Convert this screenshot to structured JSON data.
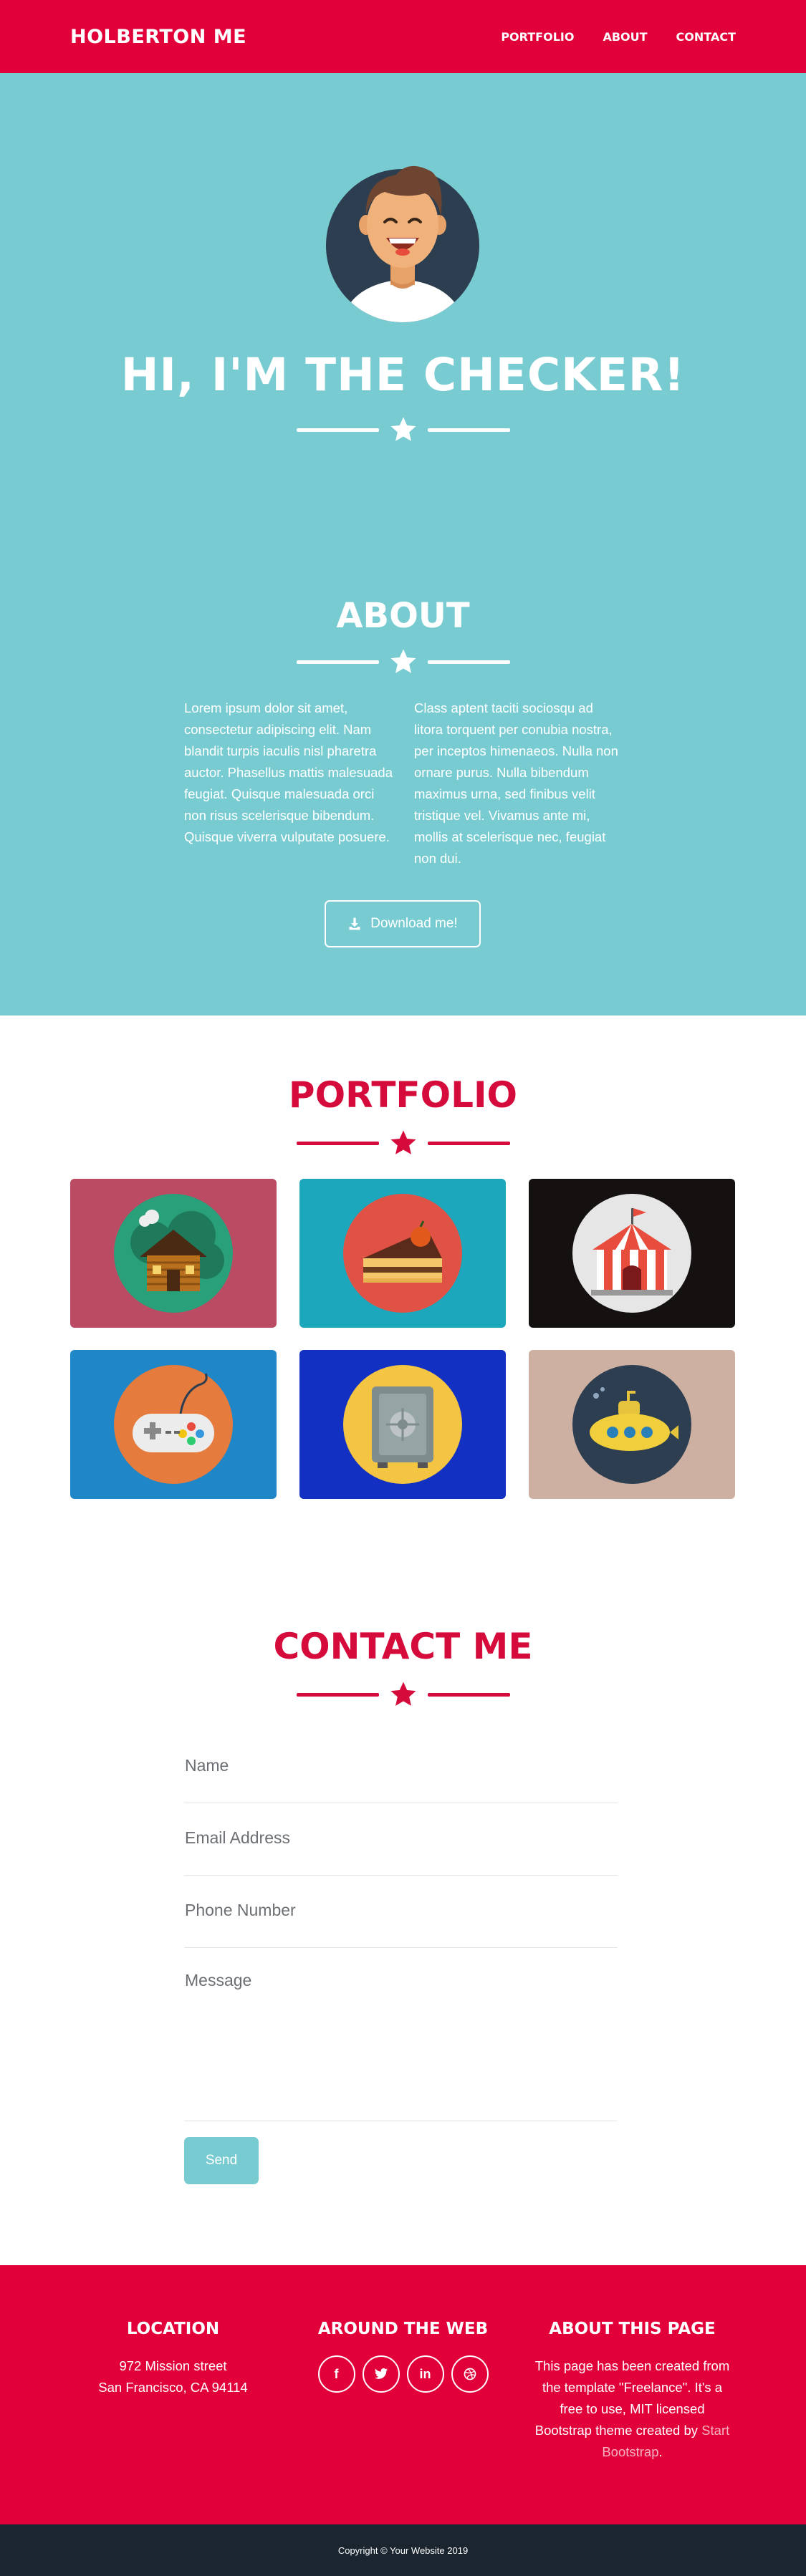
{
  "nav": {
    "brand": "HOLBERTON ME",
    "links": [
      "PORTFOLIO",
      "ABOUT",
      "CONTACT"
    ]
  },
  "hero": {
    "title": "HI, I'M THE CHECKER!"
  },
  "about": {
    "title": "ABOUT",
    "left_text": "Lorem ipsum dolor sit amet, consectetur adipiscing elit. Nam blandit turpis iaculis nisl pharetra auctor. Phasellus mattis malesuada feugiat. Quisque malesuada orci non risus scelerisque bibendum. Quisque viverra vulputate posuere.",
    "right_text": "Class aptent taciti sociosqu ad litora torquent per conubia nostra, per inceptos himenaeos. Nulla non ornare purus. Nulla bibendum maximus urna, sed finibus velit tristique vel. Vivamus ante mi, mollis at scelerisque nec, feugiat non dui.",
    "download_label": "Download me!"
  },
  "portfolio": {
    "title": "PORTFOLIO",
    "items": [
      {
        "icon": "cabin-icon",
        "bg": "#bb4a63"
      },
      {
        "icon": "cake-icon",
        "bg": "#1da7bd"
      },
      {
        "icon": "circus-tent-icon",
        "bg": "#161111"
      },
      {
        "icon": "game-controller-icon",
        "bg": "#1f86c7"
      },
      {
        "icon": "safe-icon",
        "bg": "#1230c2"
      },
      {
        "icon": "submarine-icon",
        "bg": "#cdb0a2"
      }
    ]
  },
  "contact": {
    "title": "CONTACT ME",
    "name_placeholder": "Name",
    "email_placeholder": "Email Address",
    "phone_placeholder": "Phone Number",
    "message_placeholder": "Message",
    "send_label": "Send"
  },
  "footer": {
    "location_title": "LOCATION",
    "address_line1": "972 Mission street",
    "address_line2": "San Francisco, CA 94114",
    "web_title": "AROUND THE WEB",
    "social": [
      "facebook-icon",
      "twitter-icon",
      "linkedin-icon",
      "dribbble-icon"
    ],
    "about_title": "ABOUT THIS PAGE",
    "about_text": "This page has been created from the template \"Freelance\". It's a free to use, MIT licensed Bootstrap theme created by",
    "about_link": "Start Bootstrap",
    "about_end": ".",
    "copyright": "Copyright © Your Website 2019"
  },
  "colors": {
    "primary": "#e1003a",
    "teal": "#78ccd1",
    "dark": "#1a252f",
    "heading_red": "#d40b3b"
  }
}
